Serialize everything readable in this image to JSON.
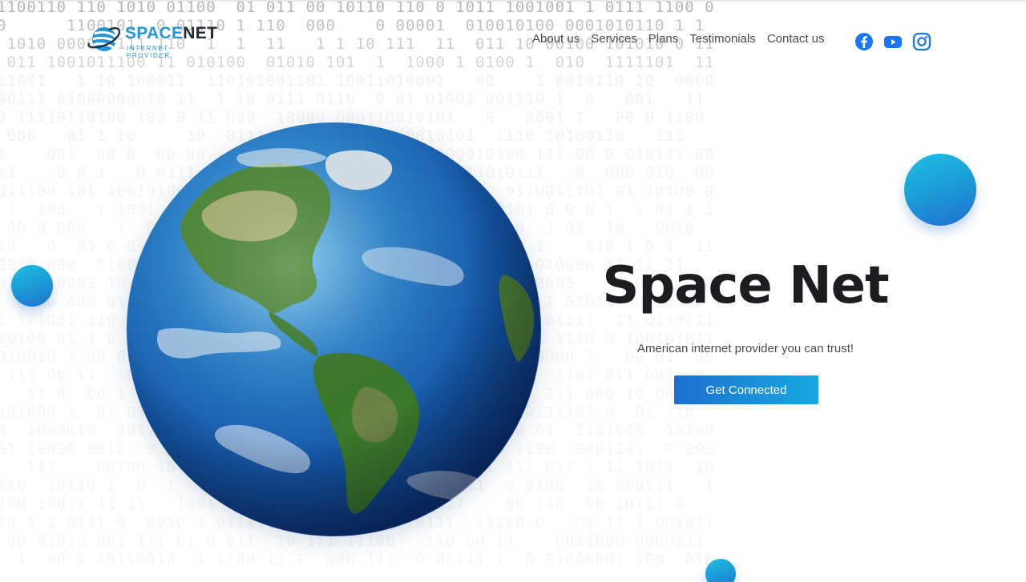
{
  "brand": {
    "name_part1": "SPACE",
    "name_part2": "NET",
    "tagline": "INTERNET PROVIDER",
    "primary_color": "#2496d6",
    "dark_color": "#1f2a33"
  },
  "nav": {
    "links": [
      "About us",
      "Services",
      "Plans",
      "Testimonials",
      "Contact us"
    ],
    "social": [
      {
        "icon": "facebook-icon",
        "color": "#1877f2"
      },
      {
        "icon": "youtube-icon",
        "color": "#1877f2"
      },
      {
        "icon": "instagram-icon",
        "color": "#1877f2"
      }
    ]
  },
  "hero": {
    "title": "Space Net",
    "subtitle": "American internet provider you can trust!",
    "cta_label": "Get Connected",
    "cta_gradient": [
      "#1e6fcf",
      "#17a9e0"
    ]
  },
  "decor": {
    "background_pattern": "binary digits",
    "accent_bubble_colors": [
      "#1cc0e3",
      "#1f6fd0"
    ]
  }
}
